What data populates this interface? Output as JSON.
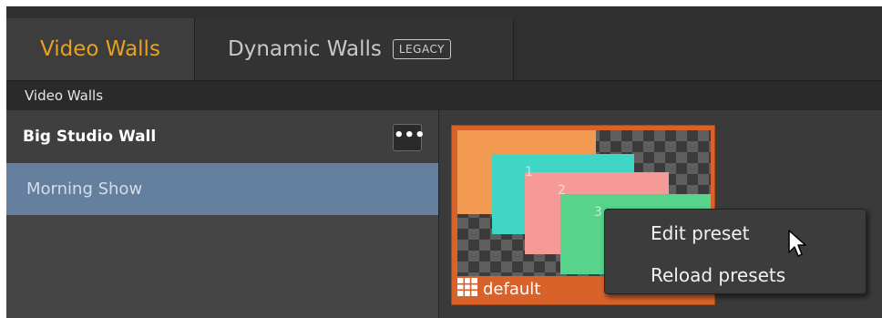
{
  "tabs": [
    {
      "label": "Video Walls",
      "active": true
    },
    {
      "label": "Dynamic Walls",
      "badge": "LEGACY",
      "active": false
    }
  ],
  "section_label": "Video Walls",
  "sidebar": {
    "group_title": "Big Studio Wall",
    "more_button": "•••",
    "items": [
      {
        "label": "Morning Show",
        "selected": true
      }
    ]
  },
  "preset": {
    "name": "default",
    "icon": "grid-icon",
    "thumbnail_numbers": [
      "1",
      "2",
      "3"
    ]
  },
  "context_menu": {
    "items": [
      {
        "label": "Edit preset"
      },
      {
        "label": "Reload presets"
      }
    ]
  },
  "colors": {
    "accent": "#e6a21e",
    "preset_border": "#d9622a",
    "selection": "#65809e"
  }
}
